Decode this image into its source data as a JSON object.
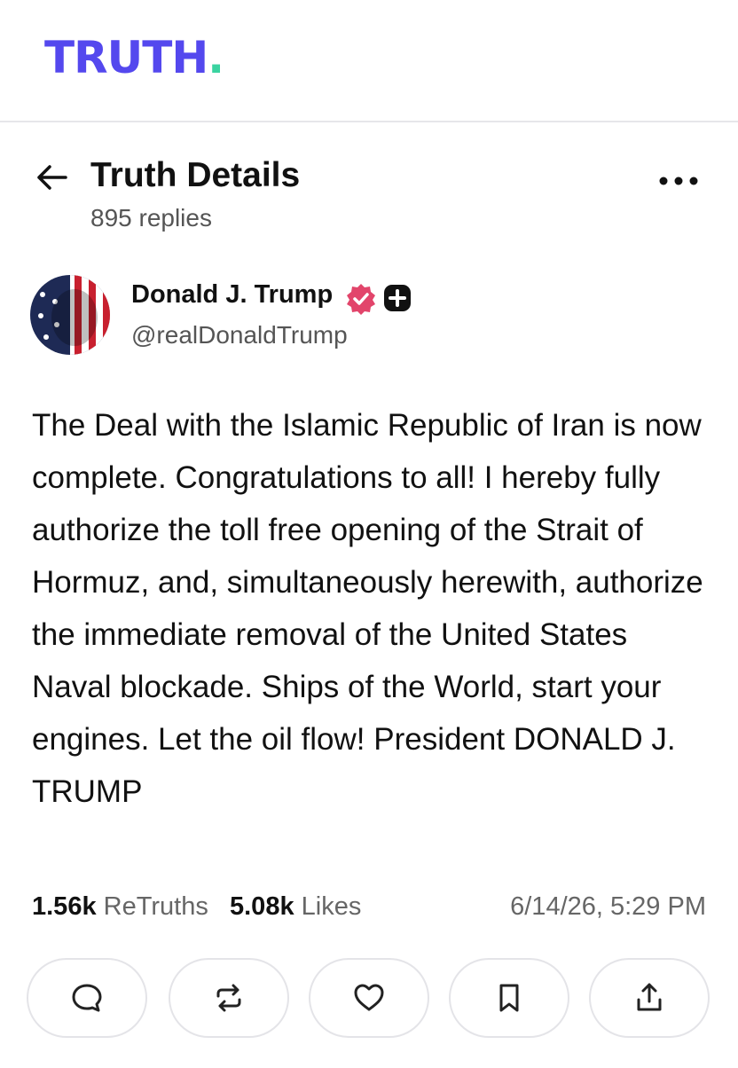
{
  "app": {
    "logo_text": "TRUTH",
    "logo_dot": ".",
    "logo_color": "#5448ee",
    "logo_dot_color": "#3ad3a0"
  },
  "header": {
    "back_icon": "arrow-left-icon",
    "title": "Truth Details",
    "replies": "895 replies",
    "more_icon": "more-horizontal-icon"
  },
  "post": {
    "author_name": "Donald J. Trump",
    "handle": "@realDonaldTrump",
    "verified_icon": "verified-badge-icon",
    "verified_color": "#e2456b",
    "plus_icon": "plus-badge-icon",
    "text": "The Deal with the Islamic Republic of Iran is now complete. Congratulations to all! I hereby fully authorize the toll free opening of the Strait of Hormuz, and, simultaneously herewith, authorize the immediate removal of the United States Naval blockade. Ships of the World, start your engines. Let the oil flow! President DONALD J. TRUMP"
  },
  "stats": {
    "retruths_count": "1.56k",
    "retruths_label": "ReTruths",
    "likes_count": "5.08k",
    "likes_label": "Likes",
    "timestamp": "6/14/26, 5:29 PM"
  },
  "actions": [
    {
      "icon": "reply-icon"
    },
    {
      "icon": "retruth-icon"
    },
    {
      "icon": "heart-icon"
    },
    {
      "icon": "bookmark-icon"
    },
    {
      "icon": "share-icon"
    }
  ]
}
